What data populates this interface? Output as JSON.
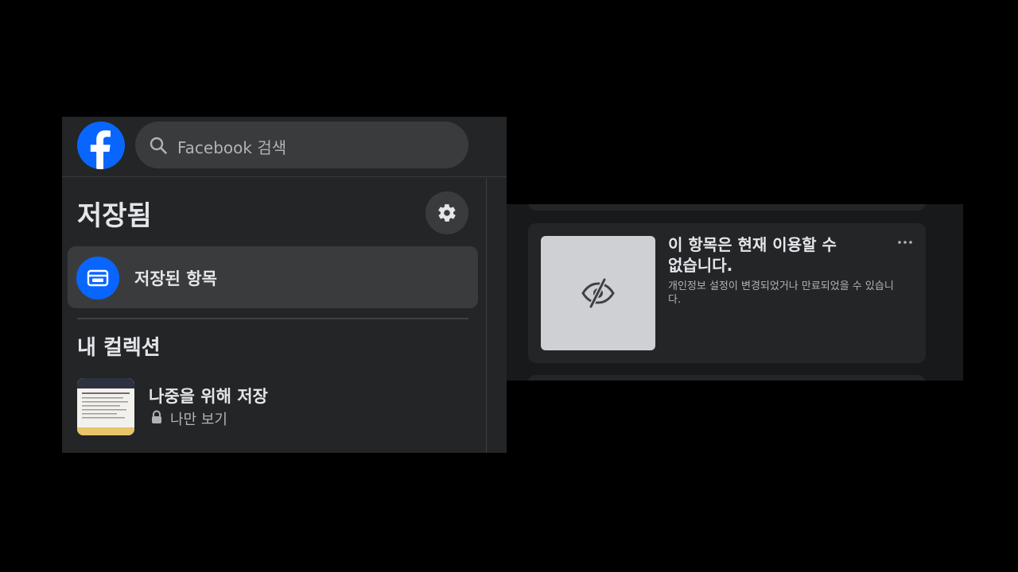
{
  "header": {
    "search": {
      "placeholder": "Facebook 검색"
    }
  },
  "sidebar": {
    "title": "저장됨",
    "nav": [
      {
        "label": "저장된 항목",
        "icon": "saved-items-icon",
        "selected": true
      }
    ],
    "collections_title": "내 컬렉션",
    "collections": [
      {
        "name": "나중을 위해 저장",
        "privacy": "나만 보기",
        "privacy_icon": "lock-icon"
      }
    ]
  },
  "main": {
    "items": [
      {
        "title": "이 항목은 현재 이용할 수 없습니다.",
        "description": "개인정보 설정이 변경되었거나 만료되었을 수 있습니다.",
        "thumbnail_icon": "eye-off-icon",
        "menu_icon": "more-icon"
      }
    ]
  },
  "colors": {
    "accent": "#0866ff",
    "panel_bg": "#242526",
    "page_bg": "#18191a",
    "hover_bg": "#3a3b3c",
    "text_primary": "#e4e6eb",
    "text_secondary": "#b0b3b8"
  }
}
